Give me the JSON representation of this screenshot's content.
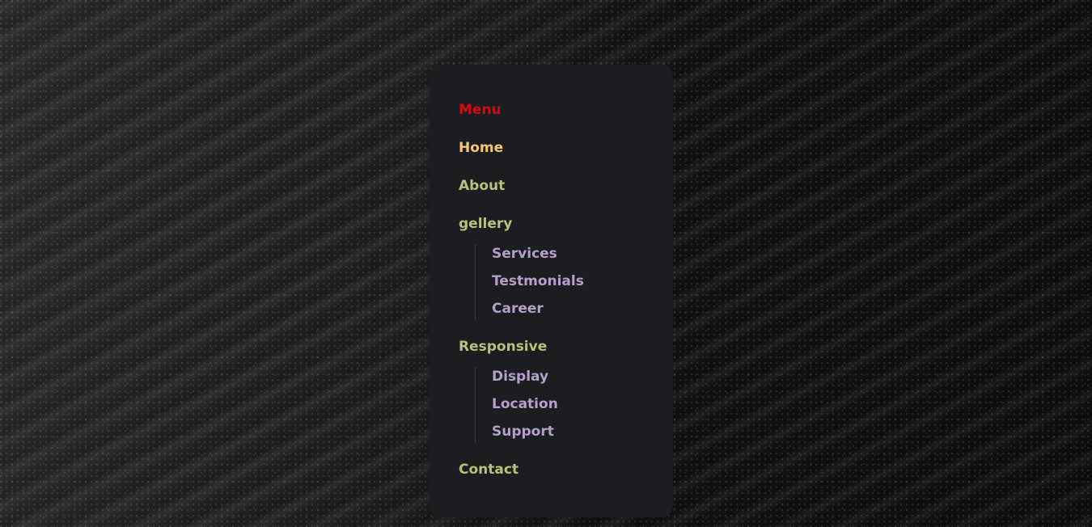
{
  "menu": {
    "title": "Menu",
    "home": "Home",
    "about": "About",
    "gallery": {
      "label": "gellery",
      "children": [
        "Services",
        "Testmonials",
        "Career"
      ]
    },
    "responsive": {
      "label": "Responsive",
      "children": [
        "Display",
        "Location",
        "Support"
      ]
    },
    "contact": "Contact"
  },
  "colors": {
    "title": "#e3000f",
    "active": "#f3c775",
    "primary": "#b5c27a",
    "submenu": "#b69fcb",
    "panel": "#1c1d20"
  }
}
